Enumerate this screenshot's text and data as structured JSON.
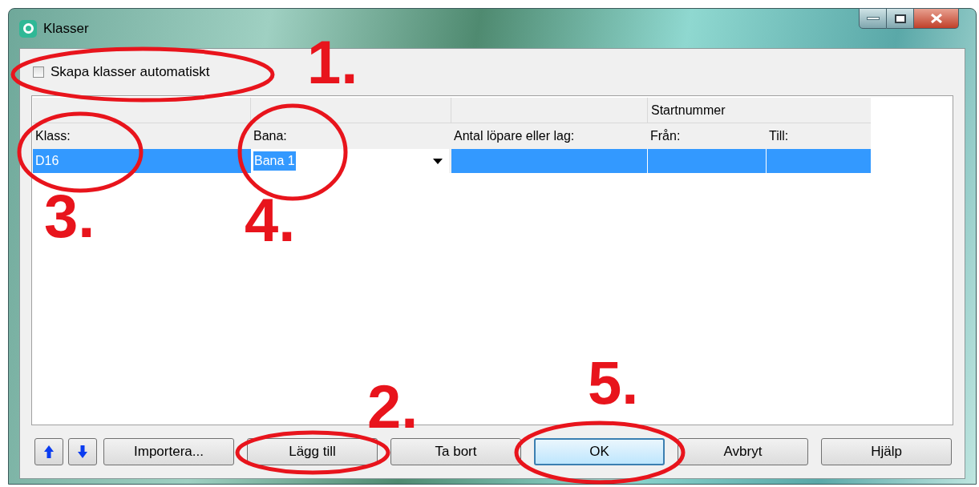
{
  "window": {
    "title": "Klasser"
  },
  "auto_create": {
    "label": "Skapa klasser automatiskt",
    "checked": false
  },
  "table": {
    "group_header": "Startnummer",
    "columns": [
      "Klass:",
      "Bana:",
      "Antal löpare eller lag:",
      "Från:",
      "Till:"
    ],
    "rows": [
      {
        "selected": true,
        "cells": [
          "D16",
          "Bana 1",
          "",
          "",
          ""
        ]
      }
    ]
  },
  "buttons": [
    {
      "kind": "up"
    },
    {
      "kind": "down"
    },
    {
      "kind": "text",
      "label": "Importera...",
      "default": false
    },
    {
      "kind": "text",
      "label": "Lägg till",
      "default": false
    },
    {
      "kind": "text",
      "label": "Ta bort",
      "default": false
    },
    {
      "kind": "text",
      "label": "OK",
      "default": true
    },
    {
      "kind": "text",
      "label": "Avbryt",
      "default": false
    },
    {
      "kind": "text",
      "label": "Hjälp",
      "default": false
    }
  ],
  "annotations": [
    "1.",
    "2.",
    "3.",
    "4.",
    "5."
  ]
}
